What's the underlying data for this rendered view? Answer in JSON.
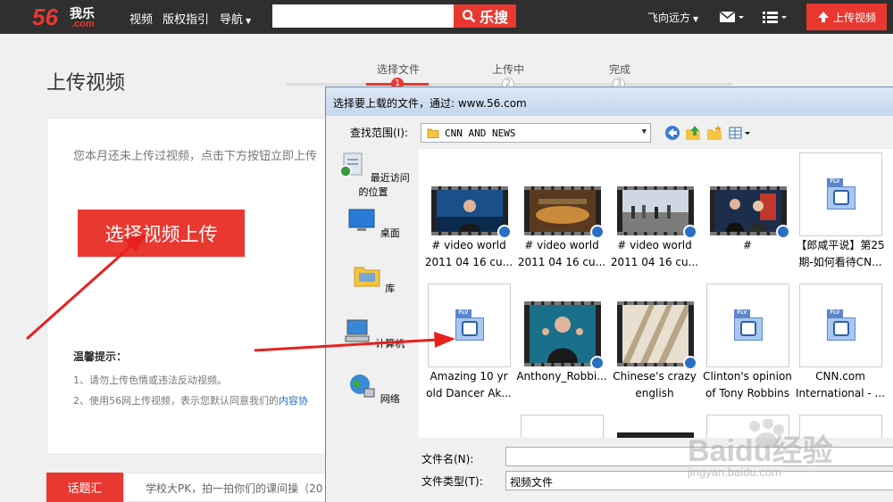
{
  "header": {
    "logo_num": "56",
    "logo_cn": "我乐",
    "logo_dom": ".com",
    "nav": [
      "视频",
      "版权指引",
      "导航"
    ],
    "search_placeholder": "",
    "search_button": "乐搜",
    "user_name": "飞向远方",
    "upload_button": "上传视频"
  },
  "page": {
    "title": "上传视频",
    "steps": [
      {
        "label": "选择文件",
        "num": "1"
      },
      {
        "label": "上传中",
        "num": "2"
      },
      {
        "label": "完成",
        "num": "3"
      }
    ],
    "notice": "您本月还未上传过视频，点击下方按钮立即上传",
    "choose_button": "选择视频上传",
    "tips_title": "温馨提示：",
    "tip1": "1、请勿上传色情或违法反动视频。",
    "tip2_prefix": "2、使用56网上传视频，表示您默认同意我们的",
    "tip2_link": "内容协",
    "topic_tag": "话题汇",
    "topic_text": "学校大PK，拍一拍你们的课间操（20"
  },
  "dialog": {
    "title": "选择要上载的文件，通过: www.56.com",
    "lookin_label": "查找范围(I):",
    "lookin_value": "CNN AND NEWS",
    "places": [
      "最近访问的位置",
      "桌面",
      "库",
      "计算机",
      "网络"
    ],
    "files": [
      {
        "line1": "# video world",
        "line2": "2011 04 16 cu..."
      },
      {
        "line1": "# video world",
        "line2": "2011 04 16 cu..."
      },
      {
        "line1": "# video world",
        "line2": "2011 04 16 cu..."
      },
      {
        "line1": "#",
        "line2": ""
      },
      {
        "line1": "【郎咸平说】第25",
        "line2": "期-如何看待CN..."
      },
      {
        "line1": "Amazing 10 yr",
        "line2": "old Dancer Ak..."
      },
      {
        "line1": "Anthony_Robbi...",
        "line2": ""
      },
      {
        "line1": "Chinese's crazy",
        "line2": "english"
      },
      {
        "line1": "Clinton's opinion",
        "line2": "of Tony Robbins"
      },
      {
        "line1": "CNN.com",
        "line2": "International - ..."
      }
    ],
    "filename_label": "文件名(N):",
    "filename_value": "",
    "filetype_label": "文件类型(T):",
    "filetype_value": "视频文件"
  },
  "watermark": {
    "text": "Baidu经验",
    "sub": "jingyan.baidu.com"
  }
}
